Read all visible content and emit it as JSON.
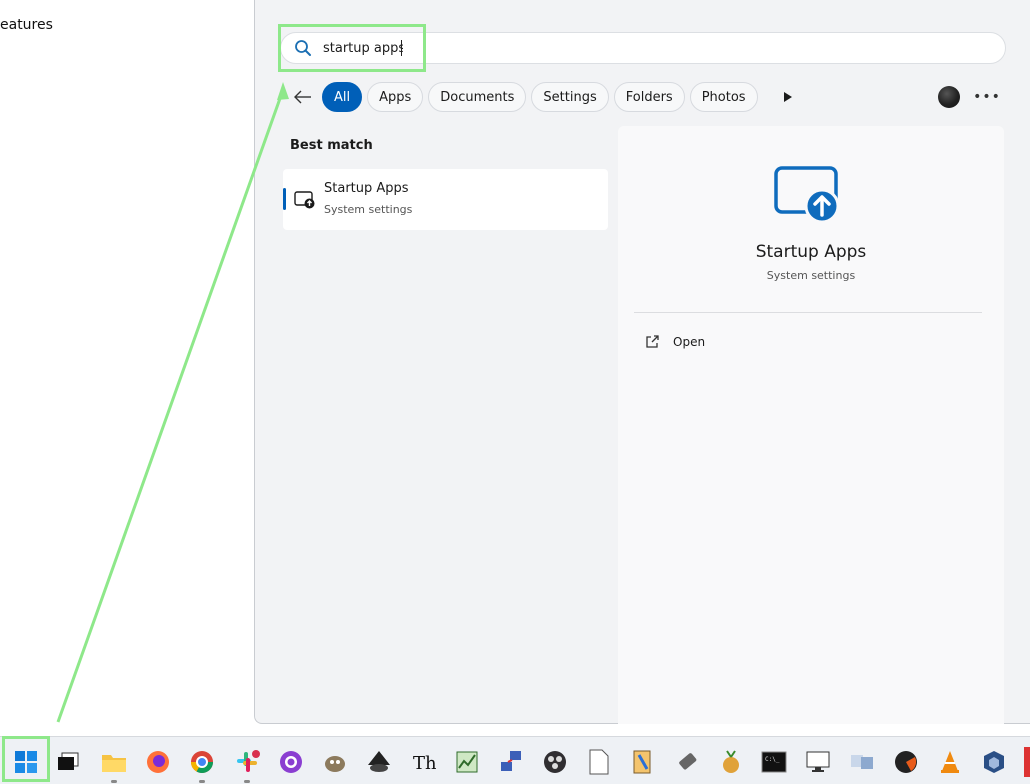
{
  "background": {
    "partial_text": "eatures"
  },
  "search": {
    "query": "startup apps"
  },
  "filters": {
    "chips": [
      {
        "label": "All",
        "active": true
      },
      {
        "label": "Apps",
        "active": false
      },
      {
        "label": "Documents",
        "active": false
      },
      {
        "label": "Settings",
        "active": false
      },
      {
        "label": "Folders",
        "active": false
      },
      {
        "label": "Photos",
        "active": false
      }
    ]
  },
  "results": {
    "section_label": "Best match",
    "best_match": {
      "title": "Startup Apps",
      "subtitle": "System settings"
    }
  },
  "detail": {
    "title": "Startup Apps",
    "subtitle": "System settings",
    "actions": [
      {
        "label": "Open"
      }
    ]
  },
  "colors": {
    "accent": "#005fb8",
    "highlight": "#8ee88a"
  },
  "taskbar": {
    "icons": [
      "windows-start-icon",
      "task-view-icon",
      "file-explorer-icon",
      "firefox-icon",
      "chrome-icon",
      "slack-icon",
      "github-desktop-icon",
      "gimp-icon",
      "inkscape-icon",
      "typora-icon",
      "task-manager-icon",
      "network-tool-icon",
      "obs-icon",
      "notepad-icon",
      "editor-icon",
      "usb-icon",
      "fruit-app-icon",
      "terminal-icon",
      "remote-desktop-icon",
      "translator-icon",
      "media-app-icon",
      "vlc-icon",
      "virtualbox-icon"
    ]
  }
}
